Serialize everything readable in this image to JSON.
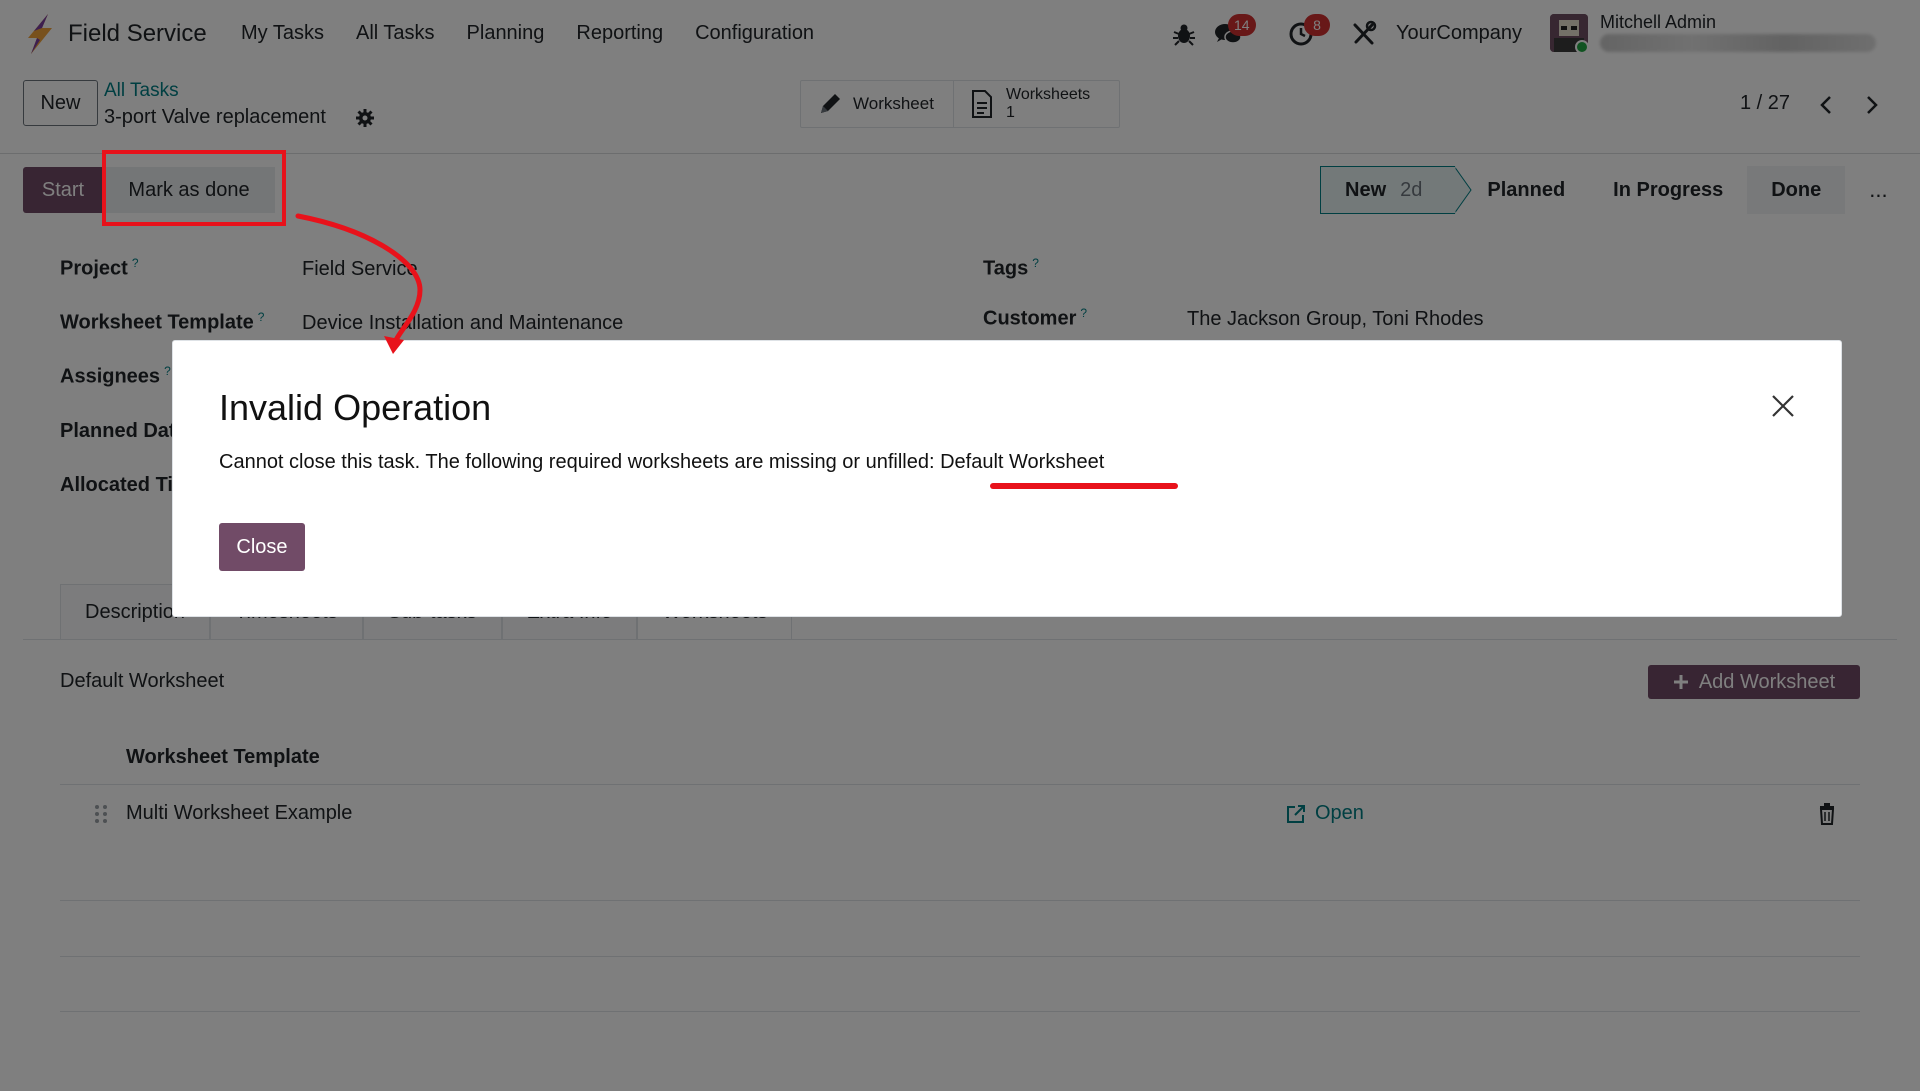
{
  "app": {
    "name": "Field Service",
    "menu": [
      "My Tasks",
      "All Tasks",
      "Planning",
      "Reporting",
      "Configuration"
    ],
    "messages_count": "14",
    "activities_count": "8",
    "company": "YourCompany",
    "user_name": "Mitchell Admin",
    "accent_color": "#714b67",
    "link_color": "#017e84"
  },
  "control": {
    "new_label": "New",
    "breadcrumb_parent": "All Tasks",
    "record_title": "3-port Valve replacement",
    "smart_buttons": {
      "worksheet_label": "Worksheet",
      "worksheets_label": "Worksheets",
      "worksheets_count": "1"
    },
    "pager": "1 / 27"
  },
  "statusbar": {
    "start_label": "Start",
    "mark_done_label": "Mark as done",
    "stages": {
      "new": "New",
      "new_days": "2d",
      "planned": "Planned",
      "in_progress": "In Progress",
      "done": "Done",
      "more": "..."
    }
  },
  "form": {
    "project_label": "Project",
    "project_value": "Field Service",
    "worksheet_template_label": "Worksheet Template",
    "worksheet_template_value": "Device Installation and Maintenance",
    "assignees_label": "Assignees",
    "planned_label": "Planned Dat",
    "allocated_label": "Allocated Ti",
    "tags_label": "Tags",
    "customer_label": "Customer",
    "customer_value": "The Jackson Group, Toni Rhodes",
    "help_mark": "?"
  },
  "tabs": {
    "description": "Description",
    "timesheets": "Timesheets",
    "subtasks": "Sub-tasks",
    "extra_info": "Extra Info",
    "worksheets": "Worksheets"
  },
  "worksheets_section": {
    "title": "Default Worksheet",
    "add_label": "Add Worksheet",
    "column_header": "Worksheet Template",
    "rows": [
      {
        "name": "Multi Worksheet Example",
        "action": "Open"
      }
    ]
  },
  "dialog": {
    "title": "Invalid Operation",
    "message": "Cannot close this task. The following required worksheets are missing or unfilled: ",
    "highlighted": "Default Worksheet",
    "close_label": "Close"
  },
  "annotation_color": "#e8121b"
}
